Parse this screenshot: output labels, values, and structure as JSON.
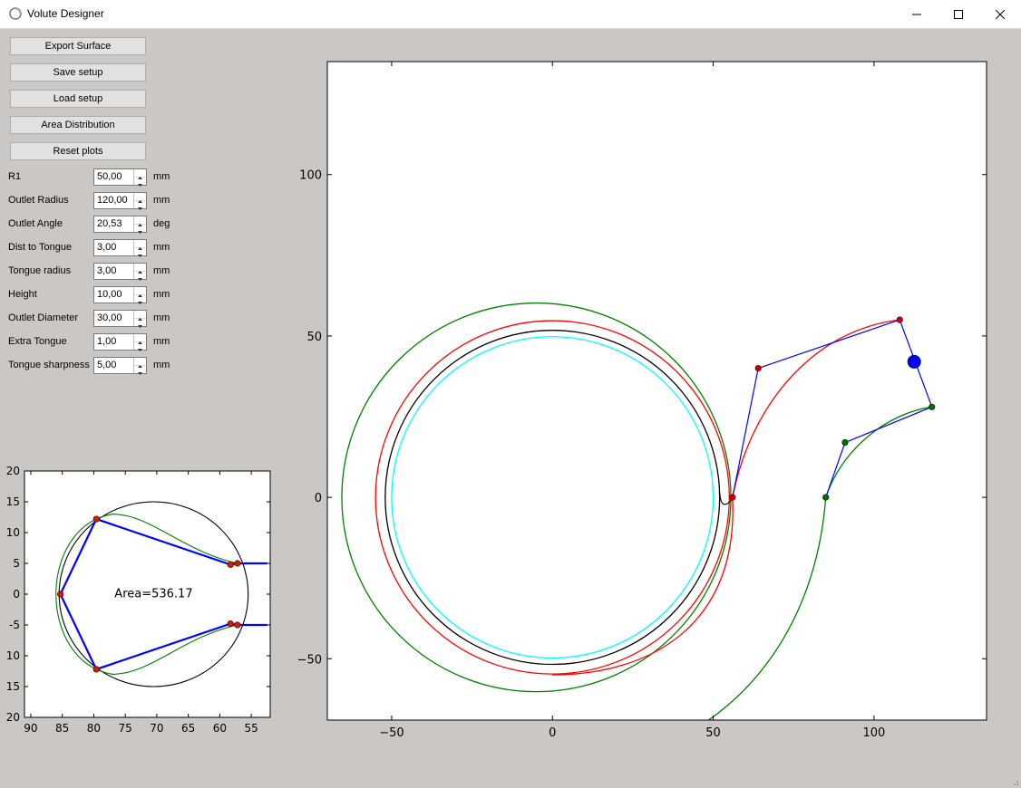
{
  "window": {
    "title": "Volute Designer"
  },
  "buttons": [
    {
      "id": "export-surface",
      "label": "Export Surface"
    },
    {
      "id": "save-setup",
      "label": "Save setup"
    },
    {
      "id": "load-setup",
      "label": "Load setup"
    },
    {
      "id": "area-distribution",
      "label": "Area Distribution"
    },
    {
      "id": "reset-plots",
      "label": "Reset plots"
    }
  ],
  "params": [
    {
      "label": "R1",
      "value": "50,00",
      "unit": "mm"
    },
    {
      "label": "Outlet Radius",
      "value": "120,00",
      "unit": "mm"
    },
    {
      "label": "Outlet Angle",
      "value": "20,53",
      "unit": "deg"
    },
    {
      "label": "Dist to Tongue",
      "value": "3,00",
      "unit": "mm"
    },
    {
      "label": "Tongue radius",
      "value": "3,00",
      "unit": "mm"
    },
    {
      "label": "Height",
      "value": "10,00",
      "unit": "mm"
    },
    {
      "label": "Outlet Diameter",
      "value": "30,00",
      "unit": "mm"
    },
    {
      "label": "Extra Tongue",
      "value": "1,00",
      "unit": "mm"
    },
    {
      "label": "Tongue sharpness",
      "value": "5,00",
      "unit": "mm"
    }
  ],
  "small_plot": {
    "annotation": "Area=536.17",
    "xticks": [
      "90",
      "85",
      "80",
      "75",
      "70",
      "65",
      "60",
      "55"
    ],
    "yticks": [
      "20",
      "15",
      "10",
      "5",
      "0",
      "-5",
      "-10",
      "-15",
      "-20"
    ],
    "yticks_visible": [
      "20",
      "15",
      "10",
      "5",
      "0",
      "-5",
      "10",
      "15",
      "20"
    ]
  },
  "chart_data": {
    "type": "line",
    "main": {
      "xlim": [
        -70,
        135
      ],
      "ylim": [
        -69,
        135
      ],
      "xticks": [
        "−50",
        "0",
        "50",
        "100"
      ],
      "yticks": [
        "100",
        "50",
        "0",
        "−50"
      ],
      "circles": [
        {
          "cx": 0,
          "cy": 0,
          "r": 50,
          "color": "#00ffff"
        },
        {
          "cx": 0,
          "cy": 0,
          "r": 52,
          "color": "#000000"
        },
        {
          "cx": 0,
          "cy": 0,
          "r": 55,
          "color": "#ff0000"
        },
        {
          "cx": -5,
          "cy": 0,
          "r": 60.5,
          "color": "#008000"
        }
      ],
      "control_red": [
        [
          56,
          0
        ],
        [
          64,
          40
        ],
        [
          108,
          55
        ]
      ],
      "control_green": [
        [
          85,
          0
        ],
        [
          91,
          17
        ],
        [
          118,
          28
        ]
      ],
      "handle": [
        112.5,
        42
      ]
    },
    "small": {
      "xlim": [
        91,
        52
      ],
      "ylim": [
        -20,
        20
      ],
      "circle": {
        "cx": 70.5,
        "cy": 0,
        "r": 15
      },
      "poly_top": [
        [
          85.3,
          0
        ],
        [
          79.6,
          12.2
        ],
        [
          58.3,
          4.8
        ],
        [
          57.2,
          5.0
        ],
        [
          52.5,
          5.0
        ]
      ],
      "poly_bottom": [
        [
          85.3,
          0
        ],
        [
          79.6,
          -12.2
        ],
        [
          58.3,
          -4.8
        ],
        [
          57.2,
          -5.0
        ],
        [
          52.5,
          -5.0
        ]
      ],
      "points": [
        [
          85.3,
          0
        ],
        [
          79.6,
          12.2
        ],
        [
          79.6,
          -12.2
        ],
        [
          58.3,
          4.8
        ],
        [
          57.2,
          5.0
        ],
        [
          58.3,
          -4.8
        ],
        [
          57.2,
          -5.0
        ]
      ]
    }
  }
}
